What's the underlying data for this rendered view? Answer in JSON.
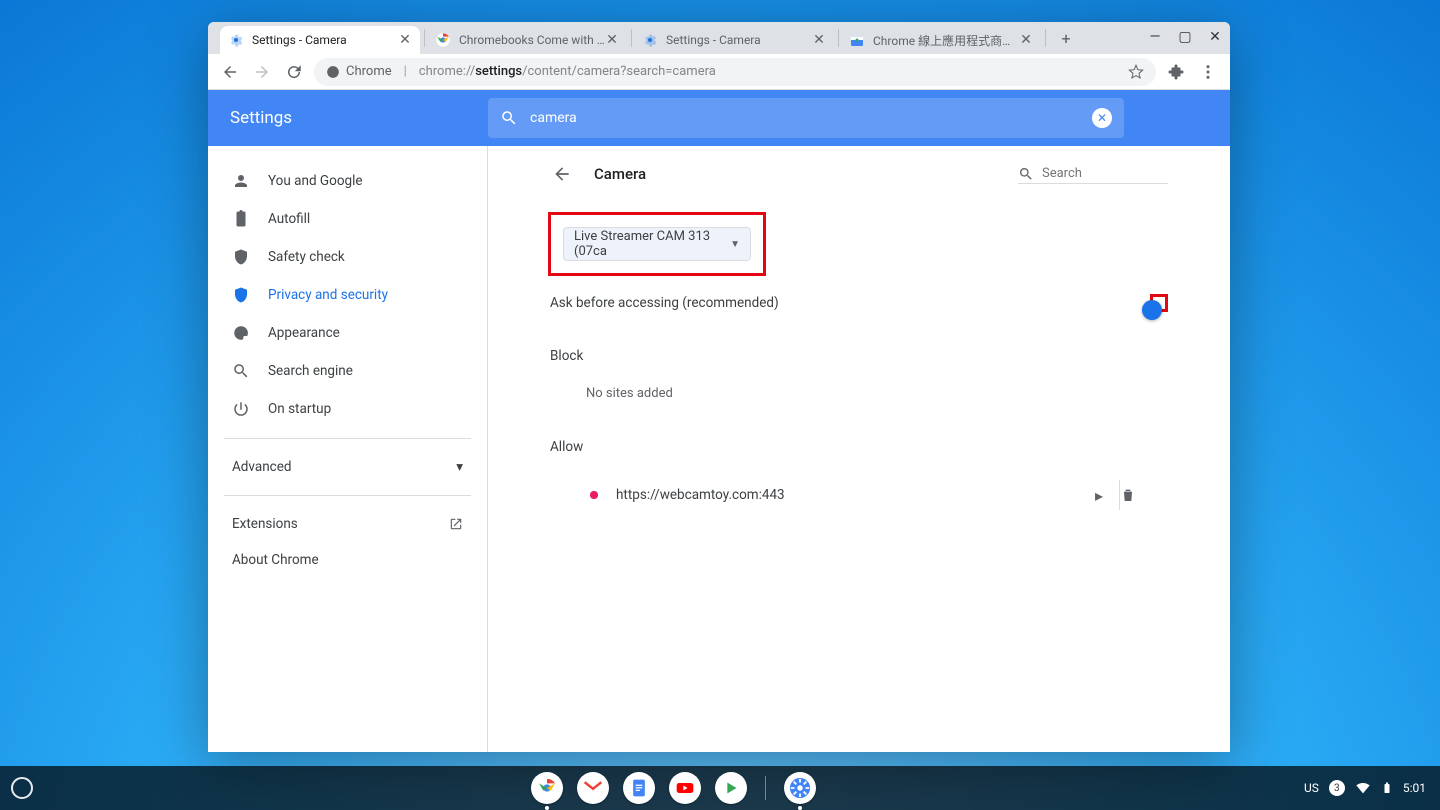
{
  "tabs": {
    "items": [
      {
        "label": "Settings - Camera"
      },
      {
        "label": "Chromebooks Come with Perks"
      },
      {
        "label": "Settings - Camera"
      },
      {
        "label": "Chrome 線上應用程式商店 - w…"
      }
    ]
  },
  "omnibox": {
    "secure_label": "Chrome",
    "url_prefix": "chrome://",
    "url_bold": "settings",
    "url_suffix": "/content/camera?search=camera"
  },
  "settings": {
    "title": "Settings",
    "search_value": "camera"
  },
  "sidebar": {
    "items": [
      {
        "label": "You and Google"
      },
      {
        "label": "Autofill"
      },
      {
        "label": "Safety check"
      },
      {
        "label": "Privacy and security"
      },
      {
        "label": "Appearance"
      },
      {
        "label": "Search engine"
      },
      {
        "label": "On startup"
      }
    ],
    "advanced_label": "Advanced",
    "extensions_label": "Extensions",
    "about_label": "About Chrome"
  },
  "main": {
    "page_title": "Camera",
    "inpage_search_placeholder": "Search",
    "device_selected": "Live Streamer CAM 313 (07ca",
    "ask_label": "Ask before accessing (recommended)",
    "block_label": "Block",
    "no_sites": "No sites added",
    "allow_label": "Allow",
    "allow_sites": [
      {
        "url": "https://webcamtoy.com:443"
      }
    ]
  },
  "shelf": {
    "ime": "US",
    "notif_count": "3",
    "time": "5:01"
  }
}
